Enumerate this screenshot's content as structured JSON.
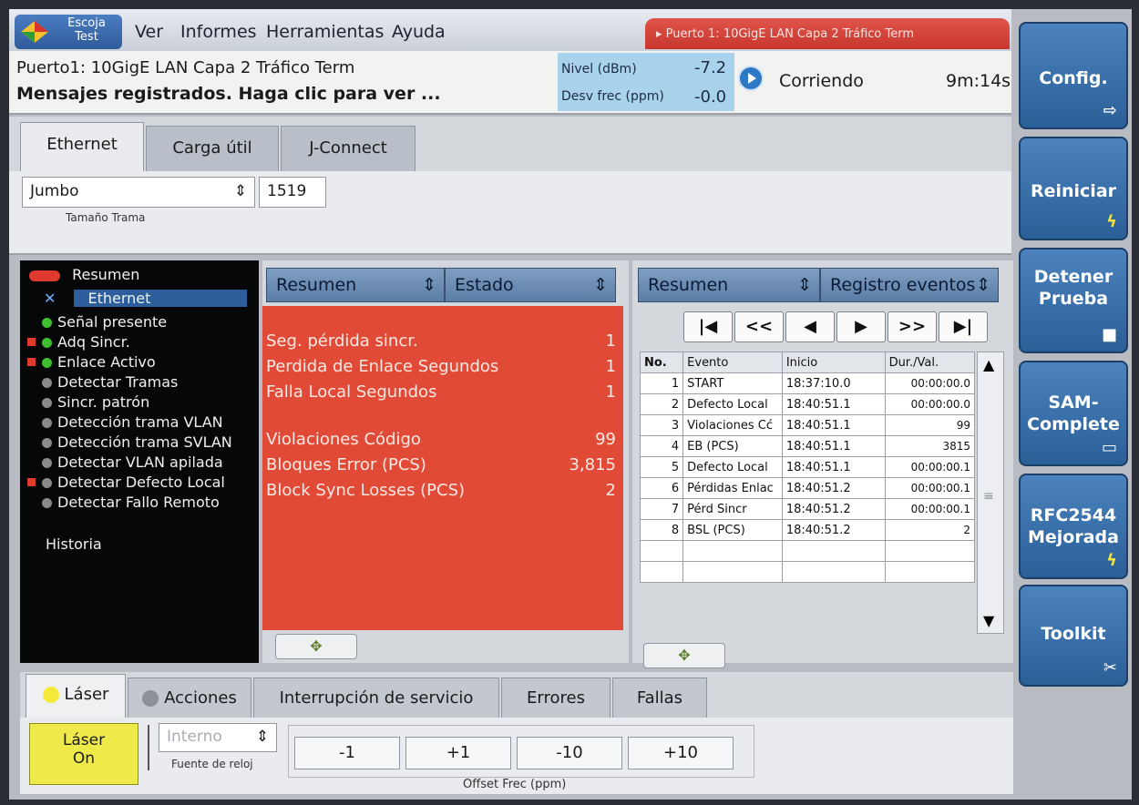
{
  "menu": {
    "logo_text": "Escoja\nTest",
    "items": [
      "Ver",
      "Informes",
      "Herramientas",
      "Ayuda"
    ],
    "port_banner": "▸ Puerto 1: 10GigE LAN Capa 2 Tráfico Term"
  },
  "status": {
    "title": "Puerto1: 10GigE LAN Capa 2 Tráfico Term",
    "message": "Mensajes registrados. Haga clic para ver ...",
    "level_label": "Nivel (dBm)",
    "level_value": "-7.2",
    "freq_label": "Desv frec (ppm)",
    "freq_value": "-0.0",
    "run_state": "Corriendo",
    "elapsed": "9m:14s"
  },
  "side_buttons": [
    {
      "label": "Config.",
      "icon": "exit-icon"
    },
    {
      "label": "Reiniciar",
      "icon": "lightning-icon"
    },
    {
      "label": "Detener\nPrueba",
      "icon": "stop-icon"
    },
    {
      "label": "SAM-\nComplete",
      "icon": "window-icon"
    },
    {
      "label": "RFC2544\nMejorada",
      "icon": "lightning-icon"
    },
    {
      "label": "Toolkit",
      "icon": "tools-icon"
    }
  ],
  "top_tabs": [
    "Ethernet",
    "Carga útil",
    "J-Connect"
  ],
  "frame": {
    "type_value": "Jumbo",
    "size_value": "1519",
    "size_label": "Tamaño Trama"
  },
  "tree": {
    "summary": "Resumen",
    "ethernet": "Ethernet",
    "items": [
      {
        "label": "Señal presente",
        "color": "#3fbf2f",
        "flag": false
      },
      {
        "label": "Adq Sincr.",
        "color": "#3fbf2f",
        "flag": true
      },
      {
        "label": "Enlace Activo",
        "color": "#3fbf2f",
        "flag": true
      },
      {
        "label": "Detectar Tramas",
        "color": "#8a8a8a",
        "flag": false
      },
      {
        "label": "Sincr. patrón",
        "color": "#8a8a8a",
        "flag": false
      },
      {
        "label": "Detección trama VLAN",
        "color": "#8a8a8a",
        "flag": false
      },
      {
        "label": "Detección trama SVLAN",
        "color": "#8a8a8a",
        "flag": false
      },
      {
        "label": "Detectar VLAN apilada",
        "color": "#8a8a8a",
        "flag": false
      },
      {
        "label": "Detectar Defecto Local",
        "color": "#8a8a8a",
        "flag": true
      },
      {
        "label": "Detectar Fallo Remoto",
        "color": "#8a8a8a",
        "flag": false
      }
    ],
    "history": "Historia"
  },
  "middle": {
    "sel_left": "Resumen",
    "sel_right": "Estado",
    "rows": [
      {
        "label": "Seg. pérdida sincr.",
        "value": "1"
      },
      {
        "label": "Perdida de Enlace Segundos",
        "value": "1"
      },
      {
        "label": "Falla Local Segundos",
        "value": "1"
      },
      {
        "label": "Violaciones Código",
        "value": "99"
      },
      {
        "label": "Bloques Error (PCS)",
        "value": "3,815"
      },
      {
        "label": "Block Sync Losses (PCS)",
        "value": "2"
      }
    ]
  },
  "right": {
    "sel_left": "Resumen",
    "sel_right": "Registro eventos",
    "nav": [
      "|◀",
      "<<",
      "◀",
      "▶",
      ">>",
      "▶|"
    ],
    "columns": [
      "No.",
      "Evento",
      "Inicio",
      "Dur./Val."
    ],
    "rows": [
      [
        "1",
        "START",
        "18:37:10.0",
        "00:00:00.0"
      ],
      [
        "2",
        "Defecto Local",
        "18:40:51.1",
        "00:00:00.0"
      ],
      [
        "3",
        "Violaciones Cć",
        "18:40:51.1",
        "99"
      ],
      [
        "4",
        "EB (PCS)",
        "18:40:51.1",
        "3815"
      ],
      [
        "5",
        "Defecto Local",
        "18:40:51.1",
        "00:00:00.1"
      ],
      [
        "6",
        "Pérdidas Enlac",
        "18:40:51.2",
        "00:00:00.1"
      ],
      [
        "7",
        "Pérd Sincr",
        "18:40:51.2",
        "00:00:00.1"
      ],
      [
        "8",
        "BSL (PCS)",
        "18:40:51.2",
        "2"
      ]
    ]
  },
  "bottom_tabs": [
    "Láser",
    "Acciones",
    "Interrupción de servicio",
    "Errores",
    "Fallas"
  ],
  "bottom": {
    "laser_btn": "Láser\nOn",
    "clock_value": "Interno",
    "clock_label": "Fuente de reloj",
    "offsets": [
      "-1",
      "+1",
      "-10",
      "+10"
    ],
    "offset_label": "Offset Frec (ppm)"
  }
}
